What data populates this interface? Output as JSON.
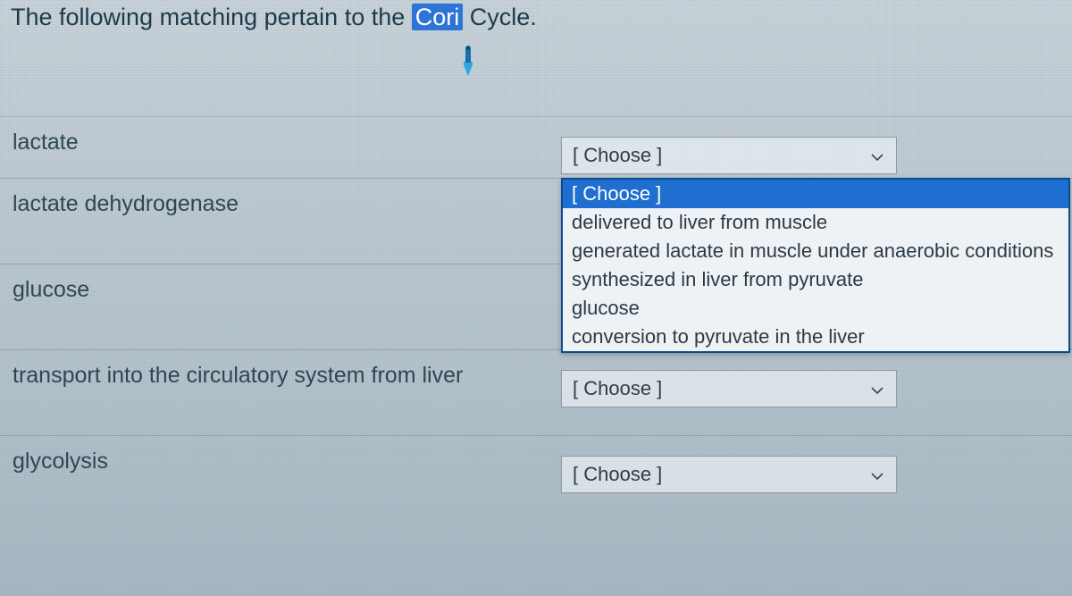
{
  "question": {
    "prefix": "The following matching pertain to the ",
    "highlight": "Cori",
    "suffix": " Cycle."
  },
  "choose_label": "[ Choose ]",
  "rows": [
    {
      "term": "lactate"
    },
    {
      "term": "lactate dehydrogenase"
    },
    {
      "term": "glucose"
    },
    {
      "term": "transport into the circulatory system from liver"
    },
    {
      "term": "glycolysis"
    }
  ],
  "dropdown": {
    "options": [
      "[ Choose ]",
      "delivered to liver from muscle",
      "generated lactate in muscle under anaerobic conditions",
      "synthesized in liver from pyruvate",
      "glucose",
      "conversion to pyruvate in the liver"
    ]
  }
}
